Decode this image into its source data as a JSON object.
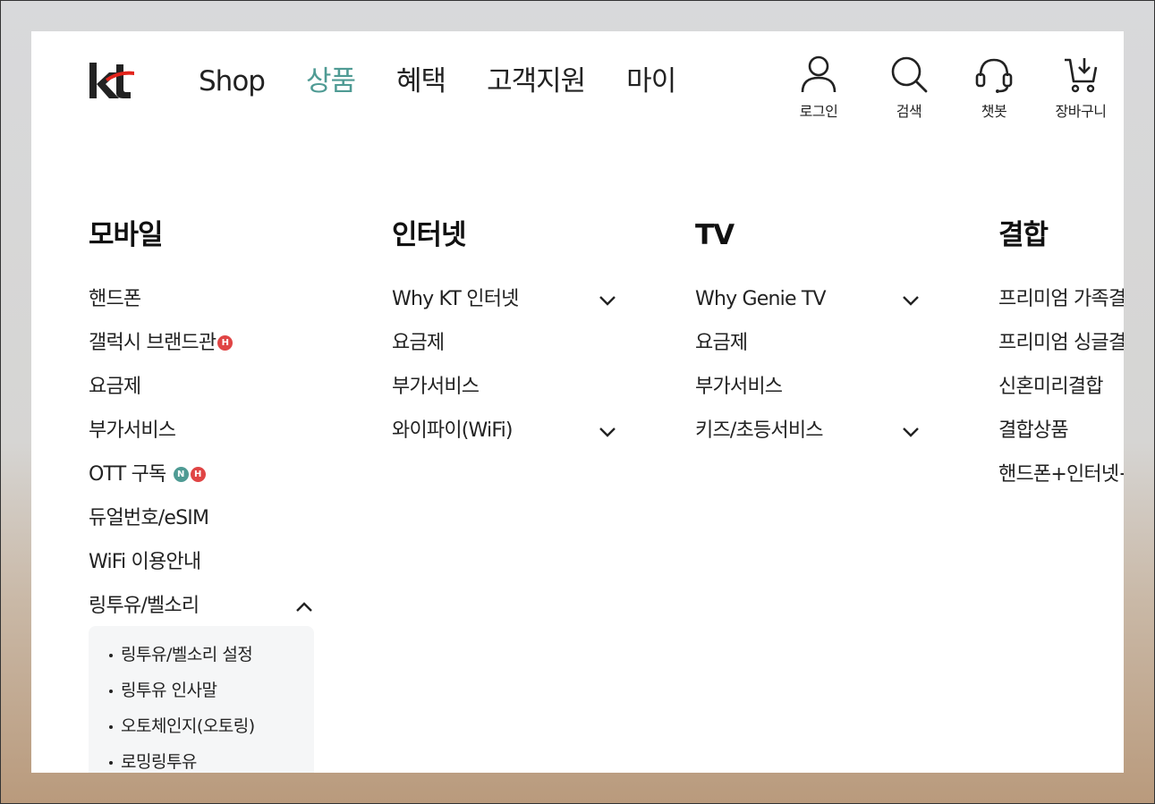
{
  "brand": {
    "logo_text": "kt"
  },
  "gnb": [
    {
      "label": "Shop"
    },
    {
      "label": "상품",
      "active": true
    },
    {
      "label": "혜택"
    },
    {
      "label": "고객지원"
    },
    {
      "label": "마이"
    }
  ],
  "utilities": {
    "login": "로그인",
    "search": "검색",
    "chatbot": "챗봇",
    "cart": "장바구니"
  },
  "columns": [
    {
      "title": "모바일",
      "items": [
        {
          "label": "핸드폰"
        },
        {
          "label": "갤럭시 브랜드관",
          "badges": [
            "H"
          ]
        },
        {
          "label": "요금제"
        },
        {
          "label": "부가서비스"
        },
        {
          "label": "OTT 구독",
          "badges": [
            "N",
            "H"
          ]
        },
        {
          "label": "듀얼번호/eSIM"
        },
        {
          "label": "WiFi 이용안내"
        },
        {
          "label": "링투유/벨소리",
          "expanded": true
        }
      ],
      "submenu": [
        "링투유/벨소리 설정",
        "링투유 인사말",
        "오토체인지(오토링)",
        "로밍링투유"
      ]
    },
    {
      "title": "인터넷",
      "items": [
        {
          "label": "Why KT 인터넷",
          "collapsible": true
        },
        {
          "label": "요금제"
        },
        {
          "label": "부가서비스"
        },
        {
          "label": "와이파이(WiFi)",
          "collapsible": true
        }
      ]
    },
    {
      "title": "TV",
      "items": [
        {
          "label": "Why Genie TV",
          "collapsible": true
        },
        {
          "label": "요금제"
        },
        {
          "label": "부가서비스"
        },
        {
          "label": "키즈/초등서비스",
          "collapsible": true
        }
      ]
    },
    {
      "title": "결합",
      "items": [
        {
          "label": "프리미엄 가족결합"
        },
        {
          "label": "프리미엄 싱글결합"
        },
        {
          "label": "신혼미리결합"
        },
        {
          "label": "결합상품"
        },
        {
          "label": "핸드폰+인터넷+TV"
        }
      ]
    }
  ],
  "colors": {
    "accent": "#4f9b94",
    "badge_hot": "#e04545",
    "logo_red": "#e2231a"
  }
}
